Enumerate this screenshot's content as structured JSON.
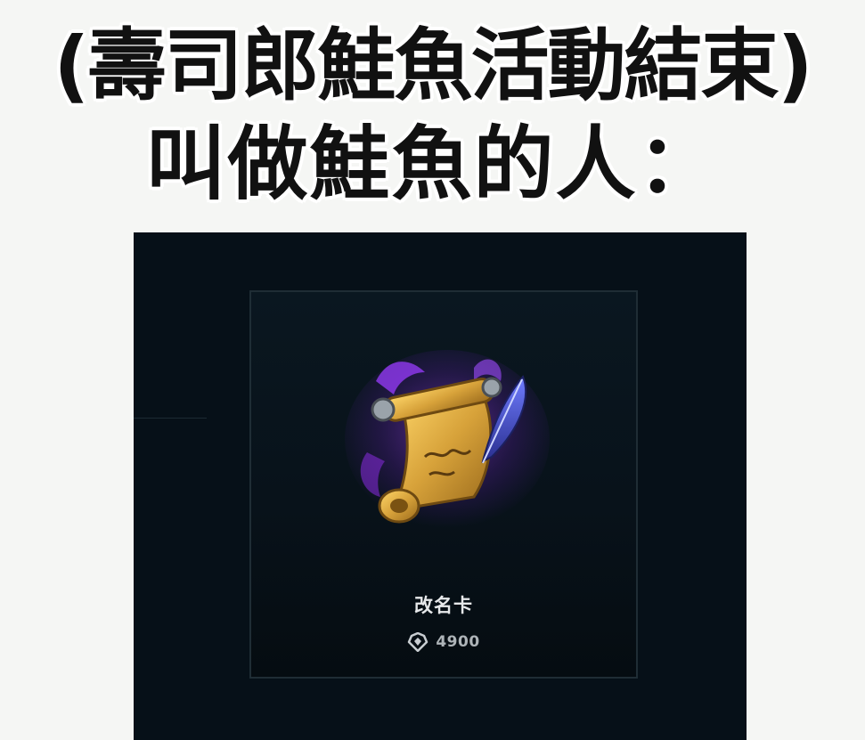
{
  "caption": {
    "line1": "(壽司郎鮭魚活動結束)",
    "line2": "叫做鮭魚的人："
  },
  "shop_item": {
    "name": "改名卡",
    "price": "4900",
    "item_icon": "rename-card-scroll-icon",
    "currency_icon": "currency-icon"
  },
  "colors": {
    "page_background": "#f5f6f4",
    "screen_background": "#061018",
    "scroll_gold": "#d7a23a",
    "glow_purple": "#8a2be2"
  }
}
